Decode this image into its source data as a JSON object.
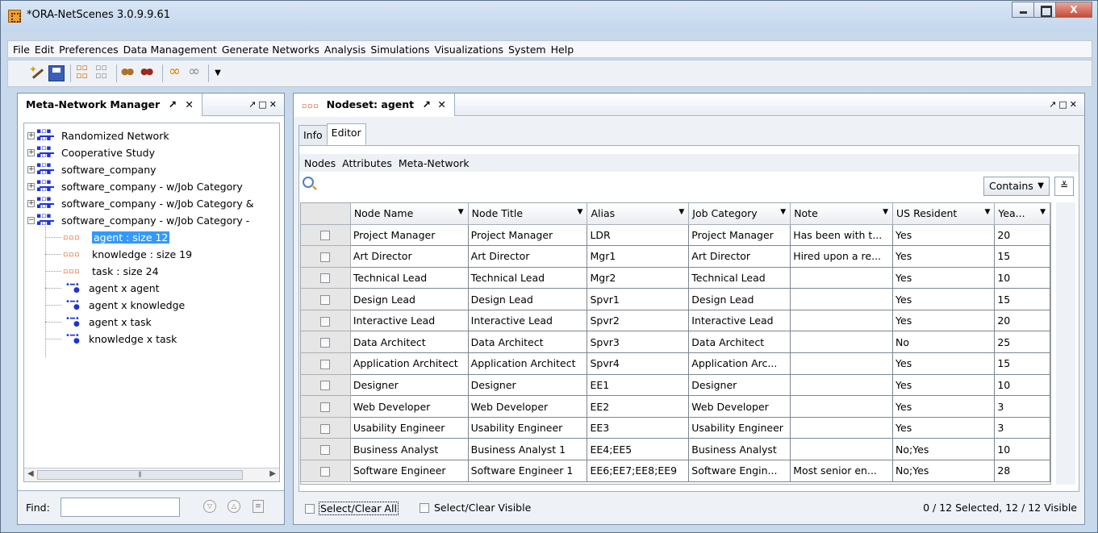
{
  "window": {
    "title": "*ORA-NetScenes 3.0.9.9.61",
    "close_label": "X"
  },
  "menubar": [
    "File",
    "Edit",
    "Preferences",
    "Data Management",
    "Generate Networks",
    "Analysis",
    "Simulations",
    "Visualizations",
    "System",
    "Help"
  ],
  "left_panel": {
    "tab_label": "Meta-Network Manager",
    "tree": [
      {
        "label": "Randomized Network"
      },
      {
        "label": "Cooperative Study"
      },
      {
        "label": "software_company"
      },
      {
        "label": "software_company - w/Job Category"
      },
      {
        "label": "software_company - w/Job Category &"
      },
      {
        "label": "software_company - w/Job Category -"
      }
    ],
    "children": [
      {
        "label": "agent : size 12",
        "type": "nodeset",
        "selected": true
      },
      {
        "label": "knowledge : size 19",
        "type": "nodeset"
      },
      {
        "label": "task : size 24",
        "type": "nodeset"
      },
      {
        "label": "agent x agent",
        "type": "network"
      },
      {
        "label": "agent x knowledge",
        "type": "network"
      },
      {
        "label": "agent x task",
        "type": "network"
      },
      {
        "label": "knowledge x task",
        "type": "network"
      }
    ],
    "find_label": "Find:",
    "find_value": ""
  },
  "right_panel": {
    "tab_label": "Nodeset: agent",
    "subtabs": [
      "Info",
      "Editor"
    ],
    "editor_menu": [
      "Nodes",
      "Attributes",
      "Meta-Network"
    ],
    "search_value": "",
    "match_mode": "Contains",
    "columns": [
      "Node Name",
      "Node Title",
      "Alias",
      "Job Category",
      "Note",
      "US Resident",
      "Yea..."
    ],
    "rows": [
      [
        "Project Manager",
        "Project Manager",
        "LDR",
        "Project Manager",
        "Has been with t...",
        "Yes",
        "20"
      ],
      [
        "Art Director",
        "Art Director",
        "Mgr1",
        "Art Director",
        "Hired upon a re...",
        "Yes",
        "15"
      ],
      [
        "Technical Lead",
        "Technical Lead",
        "Mgr2",
        "Technical Lead",
        "",
        "Yes",
        "10"
      ],
      [
        "Design Lead",
        "Design Lead",
        "Spvr1",
        "Design Lead",
        "",
        "Yes",
        "15"
      ],
      [
        "Interactive Lead",
        "Interactive Lead",
        "Spvr2",
        "Interactive Lead",
        "",
        "Yes",
        "20"
      ],
      [
        "Data Architect",
        "Data Architect",
        "Spvr3",
        "Data Architect",
        "",
        "No",
        "25"
      ],
      [
        "Application Architect",
        "Application Architect",
        "Spvr4",
        "Application Arc...",
        "",
        "Yes",
        "15"
      ],
      [
        "Designer",
        "Designer",
        "EE1",
        "Designer",
        "",
        "Yes",
        "10"
      ],
      [
        "Web Developer",
        "Web Developer",
        "EE2",
        "Web Developer",
        "",
        "Yes",
        "3"
      ],
      [
        "Usability Engineer",
        "Usability Engineer",
        "EE3",
        "Usability Engineer",
        "",
        "Yes",
        "3"
      ],
      [
        "Business Analyst",
        "Business Analyst 1",
        "EE4;EE5",
        "Business Analyst",
        "",
        "No;Yes",
        "10"
      ],
      [
        "Software Engineer",
        "Software Engineer 1",
        "EE6;EE7;EE8;EE9",
        "Software Engin...",
        "Most senior en...",
        "No;Yes",
        "28"
      ]
    ],
    "select_all_label": "Select/Clear All",
    "select_visible_label": "Select/Clear Visible",
    "status": "0 / 12 Selected, 12 / 12 Visible"
  },
  "colors": {
    "selection": "#3399ff",
    "node_icon": "#d84800",
    "network_icon": "#1d33d8"
  }
}
